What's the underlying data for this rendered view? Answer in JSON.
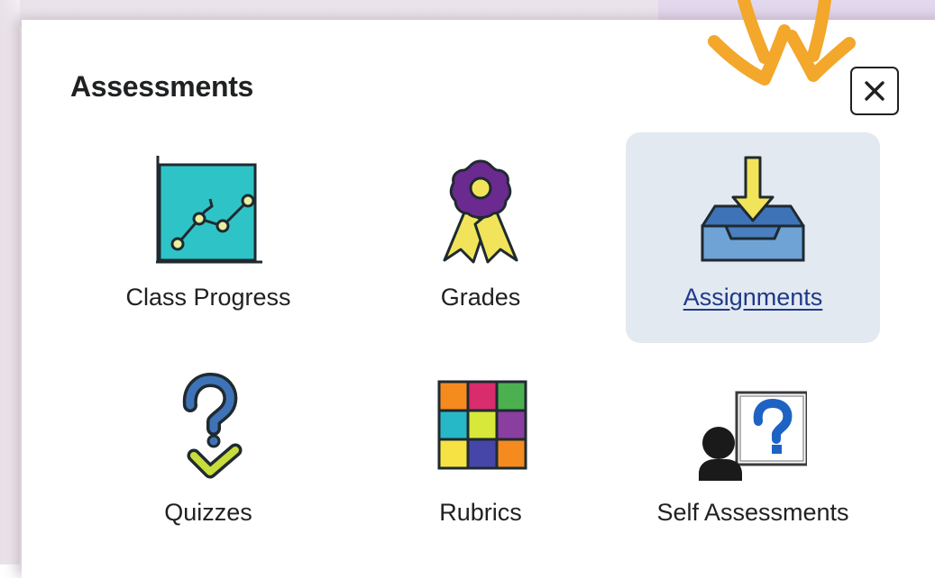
{
  "dialog": {
    "title": "Assessments",
    "close_label": "Close"
  },
  "tools": [
    {
      "label": "Class Progress",
      "icon": "chart-progress-icon",
      "selected": false
    },
    {
      "label": "Grades",
      "icon": "award-ribbon-icon",
      "selected": false
    },
    {
      "label": "Assignments",
      "icon": "inbox-download-icon",
      "selected": true
    },
    {
      "label": "Quizzes",
      "icon": "question-check-icon",
      "selected": false
    },
    {
      "label": "Rubrics",
      "icon": "color-grid-icon",
      "selected": false
    },
    {
      "label": "Self Assessments",
      "icon": "person-question-icon",
      "selected": false
    }
  ],
  "colors": {
    "selected_tile_bg": "#e3e9f1",
    "link_text": "#1e3a8a",
    "arrow_annotation": "#f3a72b"
  }
}
